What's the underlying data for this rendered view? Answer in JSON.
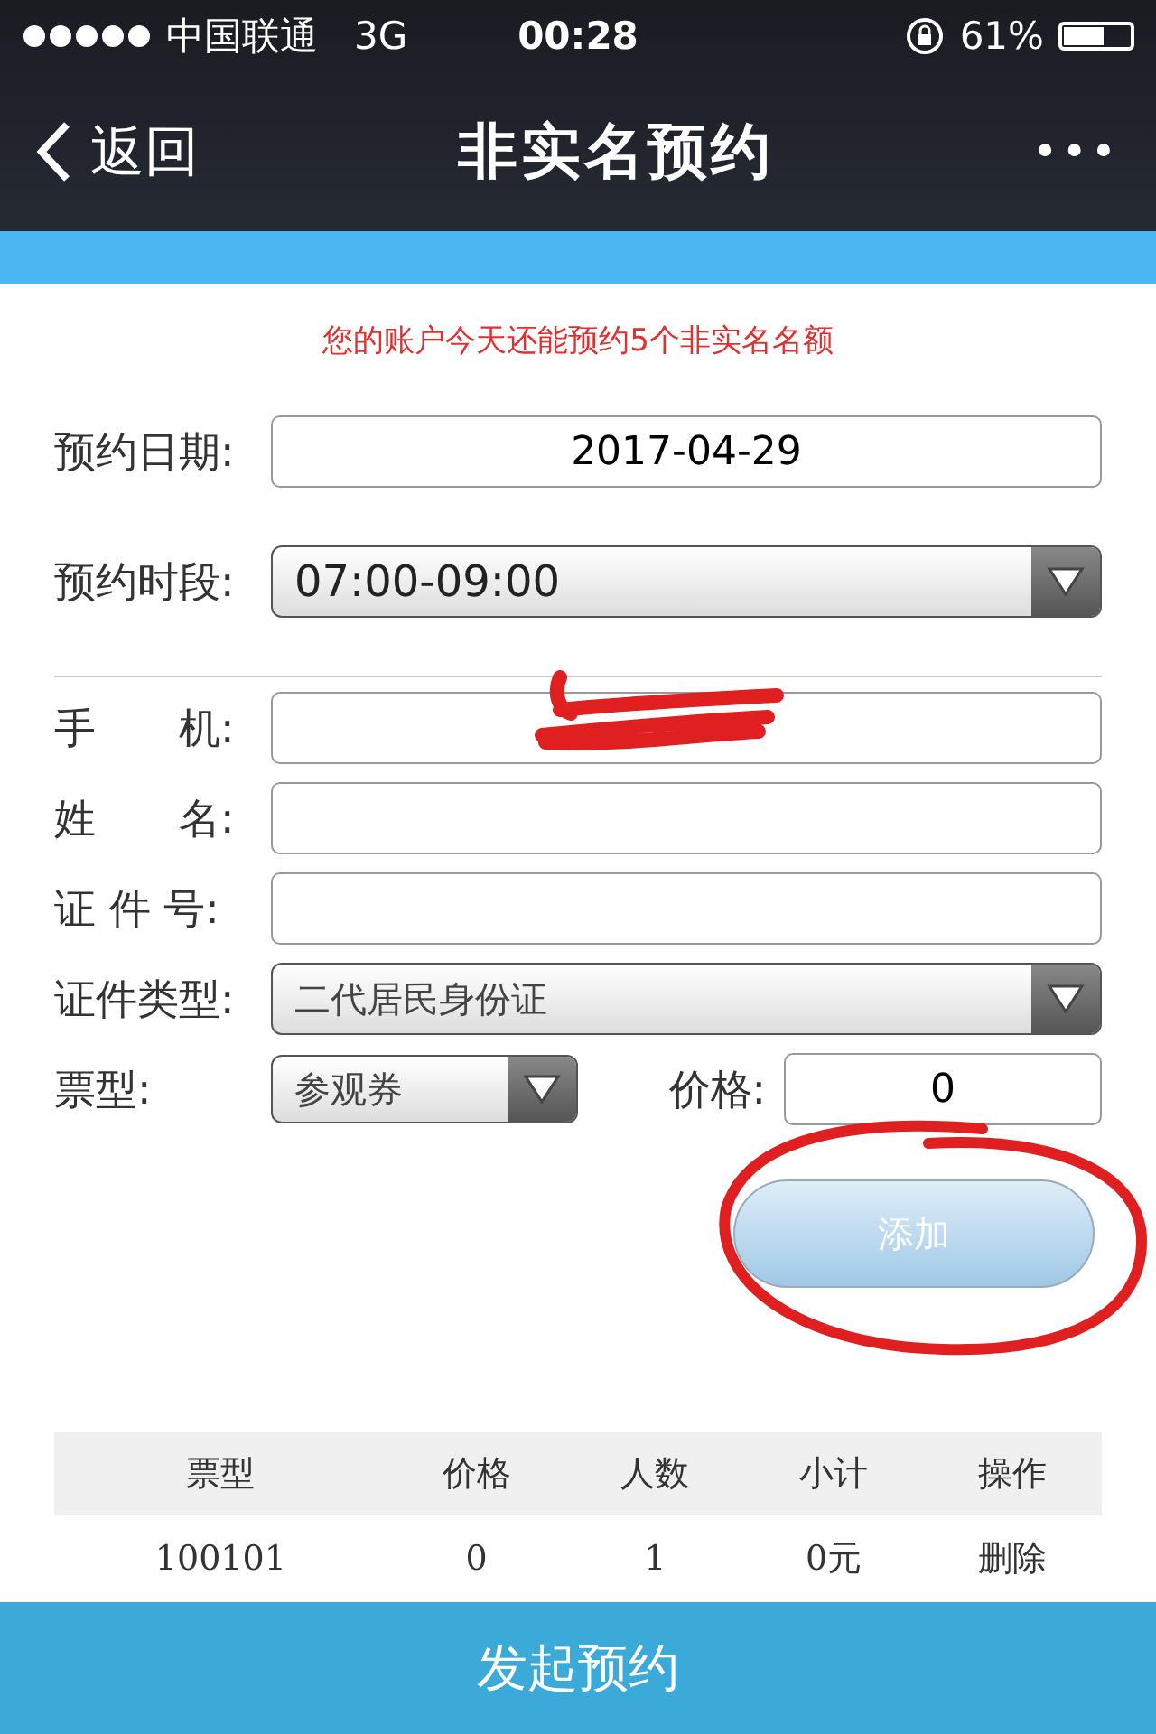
{
  "status_bar": {
    "carrier": "中国联通",
    "network": "3G",
    "time": "00:28",
    "battery": "61%"
  },
  "nav": {
    "back": "返回",
    "title": "非实名预约",
    "more": "•••"
  },
  "notice": "您的账户今天还能预约5个非实名名额",
  "date": {
    "label": "预约日期:",
    "value": "2017-04-29"
  },
  "slot": {
    "label": "预约时段:",
    "value": "07:00-09:00"
  },
  "phone": {
    "label": "手　　机:"
  },
  "name": {
    "label": "姓　　名:"
  },
  "id_number": {
    "label": "证 件 号:"
  },
  "id_type": {
    "label": "证件类型:",
    "value": "二代居民身份证"
  },
  "ticket_type": {
    "label": "票型:",
    "value": "参观券"
  },
  "price": {
    "label": "价格:",
    "value": "0"
  },
  "add_button": "添加",
  "table": {
    "columns": [
      "票型",
      "价格",
      "人数",
      "小计",
      "操作"
    ],
    "rows": [
      [
        "100101",
        "0",
        "1",
        "0元",
        "删除"
      ]
    ]
  },
  "submit_button": "发起预约"
}
